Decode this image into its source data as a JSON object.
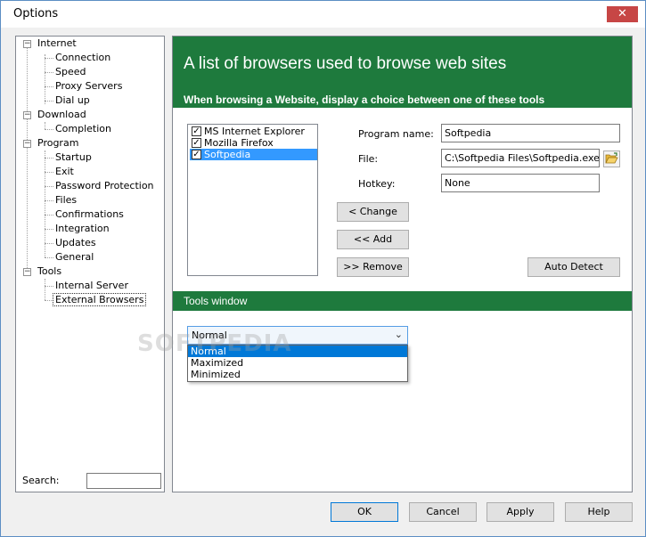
{
  "window": {
    "title": "Options",
    "close_glyph": "✕"
  },
  "tree": {
    "expand_glyph": "−",
    "groups": [
      {
        "label": "Internet",
        "children": [
          "Connection",
          "Speed",
          "Proxy Servers",
          "Dial up"
        ]
      },
      {
        "label": "Download",
        "children": [
          "Completion"
        ]
      },
      {
        "label": "Program",
        "children": [
          "Startup",
          "Exit",
          "Password Protection",
          "Files",
          "Confirmations",
          "Integration",
          "Updates",
          "General"
        ]
      },
      {
        "label": "Tools",
        "children": [
          "Internal Server",
          "External Browsers"
        ]
      }
    ],
    "selected": "External Browsers"
  },
  "search": {
    "label": "Search:",
    "value": ""
  },
  "panel": {
    "title": "A list of browsers used to browse web sites",
    "subtitle": "When browsing a Website, display a choice between one of these tools"
  },
  "browsers": {
    "items": [
      {
        "label": "MS Internet Explorer",
        "checked": true
      },
      {
        "label": "Mozilla Firefox",
        "checked": true
      },
      {
        "label": "Softpedia",
        "checked": true
      }
    ],
    "selected_index": 2,
    "check_glyph": "✓"
  },
  "fields": {
    "program_name_label": "Program name:",
    "program_name_value": "Softpedia",
    "file_label": "File:",
    "file_value": "C:\\Softpedia Files\\Softpedia.exe",
    "hotkey_label": "Hotkey:",
    "hotkey_value": "None"
  },
  "buttons": {
    "change": "<  Change",
    "add": "<<     Add",
    "remove": ">> Remove",
    "auto_detect": "Auto Detect",
    "ok": "OK",
    "cancel": "Cancel",
    "apply": "Apply",
    "help": "Help"
  },
  "tools_window": {
    "label": "Tools window",
    "selected": "Normal",
    "arrow_glyph": "⌄",
    "options": [
      "Normal",
      "Maximized",
      "Minimized"
    ]
  },
  "watermark": "SOFTPEDIA",
  "icons": {
    "folder": "folder-open-icon"
  },
  "colors": {
    "accent_green": "#1e7a3d",
    "selection_blue": "#3399ff",
    "close_red": "#c74645"
  }
}
